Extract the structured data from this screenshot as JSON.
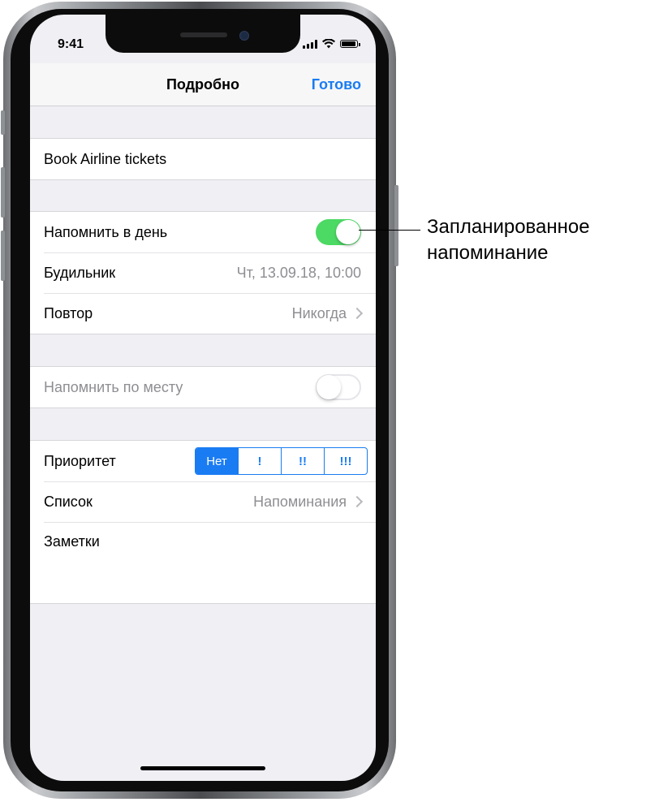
{
  "status_bar": {
    "time": "9:41"
  },
  "nav": {
    "title": "Подробно",
    "done": "Готово"
  },
  "task": {
    "title": "Book Airline tickets"
  },
  "reminder": {
    "remind_day_label": "Напомнить в день",
    "remind_day_on": true,
    "alarm_label": "Будильник",
    "alarm_value": "Чт, 13.09.18, 10:00",
    "repeat_label": "Повтор",
    "repeat_value": "Никогда"
  },
  "location": {
    "label": "Напомнить по месту",
    "on": false
  },
  "details": {
    "priority_label": "Приоритет",
    "priority_options": [
      "Нет",
      "!",
      "!!",
      "!!!"
    ],
    "priority_selected": "Нет",
    "list_label": "Список",
    "list_value": "Напоминания",
    "notes_label": "Заметки"
  },
  "callout": {
    "line1": "Запланированное",
    "line2": "напоминание"
  },
  "colors": {
    "accent": "#1a7cf2",
    "toggle_on": "#4cd964",
    "background": "#efeff4"
  }
}
